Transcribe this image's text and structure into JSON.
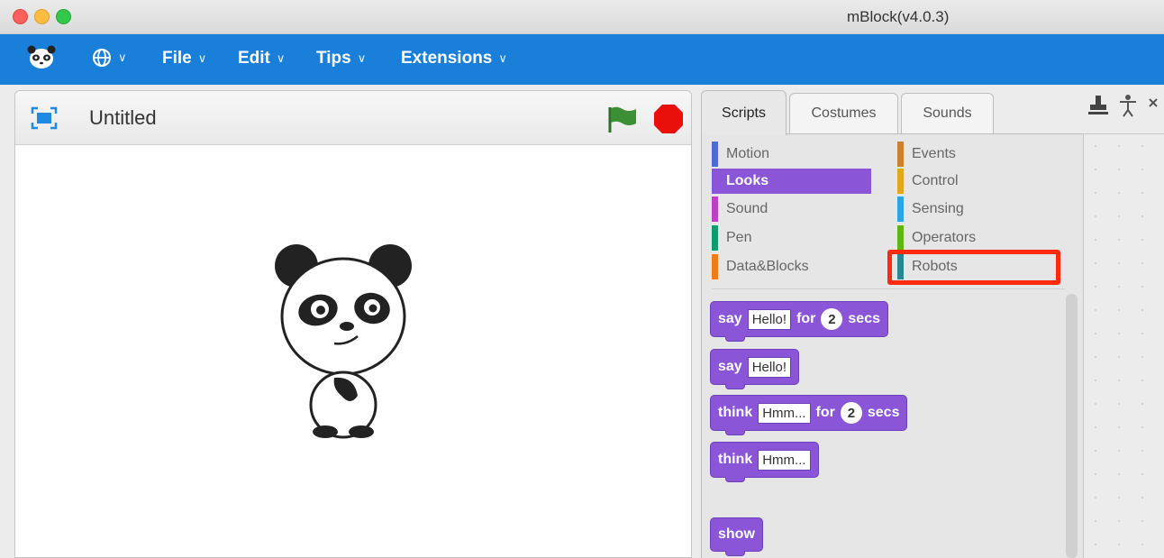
{
  "window": {
    "title": "mBlock(v4.0.3)"
  },
  "menubar": {
    "items": [
      {
        "label": "File"
      },
      {
        "label": "Edit"
      },
      {
        "label": "Tips"
      },
      {
        "label": "Extensions"
      }
    ],
    "chevron": "∨"
  },
  "stage": {
    "title": "Untitled"
  },
  "tabs": [
    {
      "label": "Scripts",
      "active": true
    },
    {
      "label": "Costumes",
      "active": false
    },
    {
      "label": "Sounds",
      "active": false
    }
  ],
  "categories": [
    {
      "label": "Motion",
      "color": "#4a6cd4"
    },
    {
      "label": "Events",
      "color": "#c88330"
    },
    {
      "label": "Looks",
      "color": "#8a55d7",
      "selected": true
    },
    {
      "label": "Control",
      "color": "#e1a91a"
    },
    {
      "label": "Sound",
      "color": "#bb42c3"
    },
    {
      "label": "Sensing",
      "color": "#2ca5e2"
    },
    {
      "label": "Pen",
      "color": "#0e9a6c"
    },
    {
      "label": "Operators",
      "color": "#5cb712"
    },
    {
      "label": "Data&Blocks",
      "color": "#ee7d16"
    },
    {
      "label": "Robots",
      "color": "#2a8596"
    }
  ],
  "blocks": [
    {
      "verb": "say",
      "field": "Hello!",
      "mid": "for",
      "num": "2",
      "tail": "secs"
    },
    {
      "verb": "say",
      "field": "Hello!"
    },
    {
      "verb": "think",
      "field": "Hmm...",
      "mid": "for",
      "num": "2",
      "tail": "secs"
    },
    {
      "verb": "think",
      "field": "Hmm..."
    },
    {
      "verb": "show"
    }
  ],
  "colors": {
    "menubar": "#1a7fd9",
    "looks": "#8a55d7",
    "highlight": "#ff2a10"
  }
}
